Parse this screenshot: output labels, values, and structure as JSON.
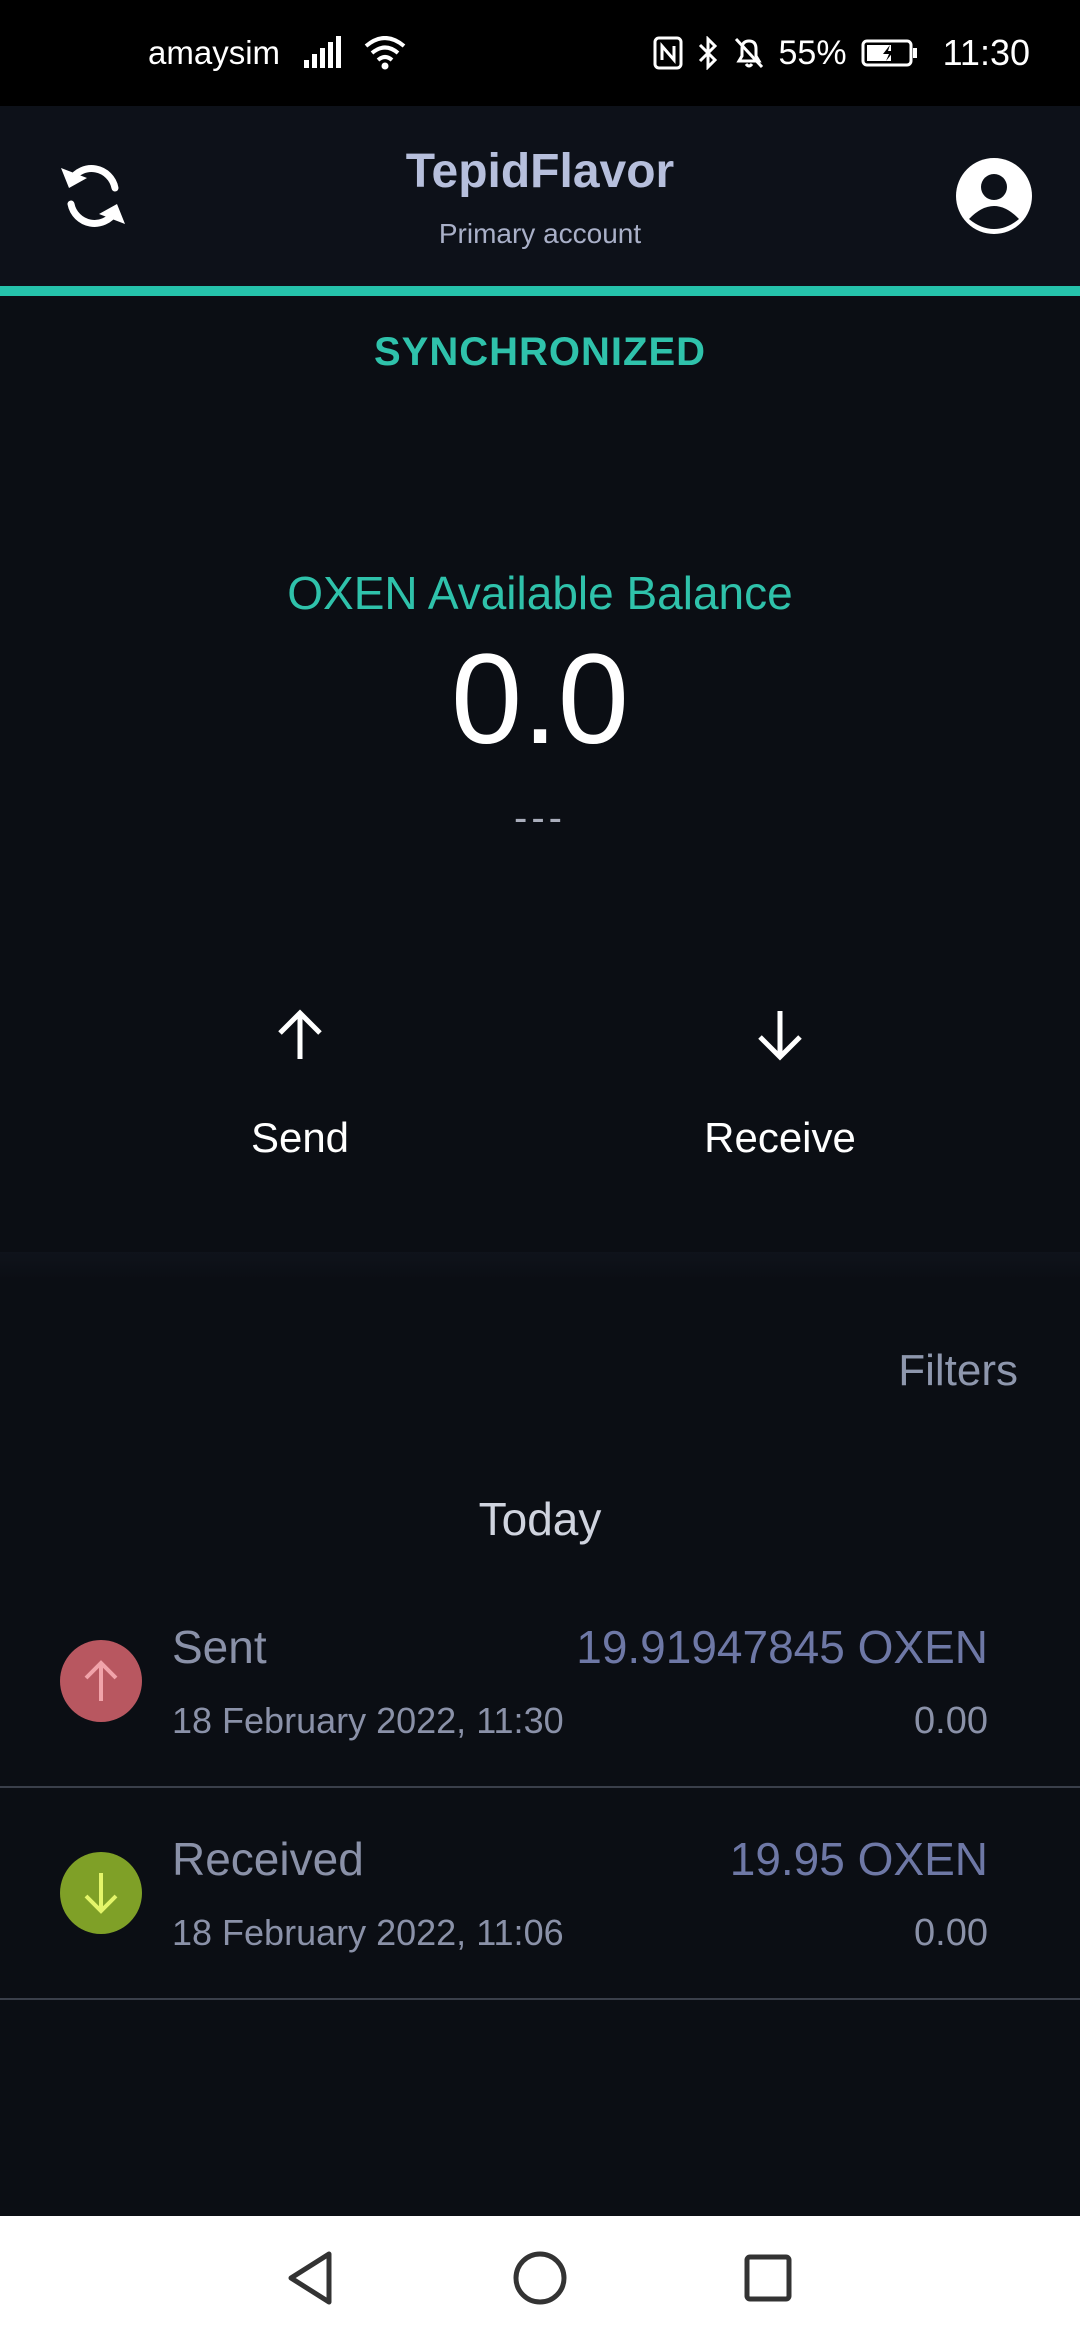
{
  "status_bar": {
    "carrier": "amaysim",
    "battery_percent": "55%",
    "time": "11:30",
    "icons": [
      "signal-icon",
      "wifi-icon",
      "nfc-icon",
      "bluetooth-icon",
      "mute-icon",
      "battery-icon"
    ]
  },
  "header": {
    "wallet_name": "TepidFlavor",
    "account_label": "Primary account",
    "left_icon": "sync-icon",
    "right_icon": "account-icon"
  },
  "sync": {
    "status": "SYNCHRONIZED",
    "progress_fraction": 1.0
  },
  "balance": {
    "label": "OXEN Available Balance",
    "value": "0.0",
    "fiat": "---"
  },
  "actions": {
    "send_label": "Send",
    "receive_label": "Receive"
  },
  "transactions": {
    "filters_label": "Filters",
    "group_label": "Today",
    "items": [
      {
        "type": "Sent",
        "date": "18 February 2022, 11:30",
        "amount": "19.91947845 OXEN",
        "fiat": "0.00",
        "direction": "outgoing"
      },
      {
        "type": "Received",
        "date": "18 February 2022, 11:06",
        "amount": "19.95 OXEN",
        "fiat": "0.00",
        "direction": "incoming"
      }
    ]
  },
  "colors": {
    "accent": "#2fc2ab",
    "background": "#0b0e14",
    "sent_badge": "#b85760",
    "received_badge": "#7fa027"
  }
}
